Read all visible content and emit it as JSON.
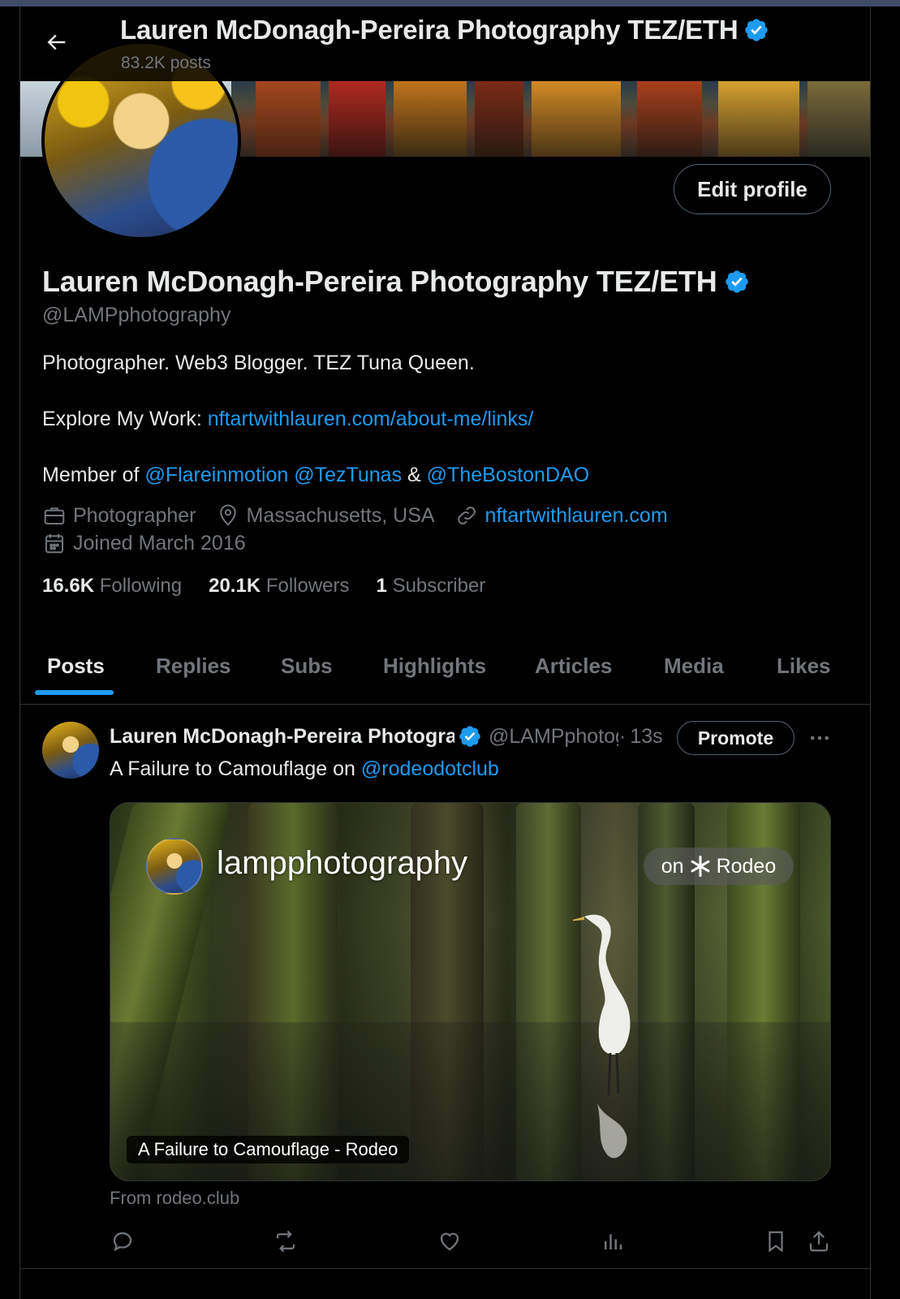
{
  "header": {
    "title": "Lauren McDonagh-Pereira Photography TEZ/ETH",
    "posts_count": "83.2K posts"
  },
  "profile": {
    "edit_label": "Edit profile",
    "name": "Lauren McDonagh-Pereira Photography TEZ/ETH",
    "handle": "@LAMPphotography",
    "bio_line1": "Photographer. Web3 Blogger. TEZ Tuna Queen.",
    "bio_explore_prefix": "Explore My Work: ",
    "bio_explore_link": "nftartwithlauren.com/about-me/links/",
    "bio_member_prefix": "Member of ",
    "bio_mention1": "@Flareinmotion",
    "bio_mention2": "@TezTunas",
    "bio_amp": "&",
    "bio_mention3": "@TheBostonDAO",
    "occupation": "Photographer",
    "location": "Massachusetts, USA",
    "website": "nftartwithlauren.com",
    "joined": "Joined March 2016",
    "following_count": "16.6K",
    "following_label": "Following",
    "followers_count": "20.1K",
    "followers_label": "Followers",
    "subscriber_count": "1",
    "subscriber_label": "Subscriber"
  },
  "tabs": [
    {
      "label": "Posts",
      "active": true
    },
    {
      "label": "Replies"
    },
    {
      "label": "Subs"
    },
    {
      "label": "Highlights"
    },
    {
      "label": "Articles"
    },
    {
      "label": "Media"
    },
    {
      "label": "Likes"
    }
  ],
  "tweet": {
    "author_name": "Lauren McDonagh-Pereira Photography TEZ/ETH",
    "author_handle": "@LAMPphotography",
    "dot": "·",
    "time": "13s",
    "promote_label": "Promote",
    "text_prefix": "A Failure to Camouflage on ",
    "text_mention": "@rodeodotclub",
    "card": {
      "brand": "lampphotography",
      "pill_on": "on",
      "pill_name": "Rodeo",
      "caption": "A Failure to Camouflage - Rodeo"
    },
    "from": "From rodeo.club"
  },
  "icons": {
    "back": "arrow-left-icon",
    "verified": "verified-badge-icon",
    "occupation": "briefcase-icon",
    "location": "map-pin-icon",
    "website": "link-icon",
    "joined": "calendar-icon",
    "more": "more-dots-icon",
    "reply": "reply-icon",
    "repost": "repost-icon",
    "like": "heart-icon",
    "views": "views-icon",
    "bookmark": "bookmark-icon",
    "share": "share-icon"
  },
  "colors": {
    "accent": "#1d9bf0",
    "muted": "#71767b",
    "text": "#e7e9ea",
    "border": "#2f3336"
  }
}
